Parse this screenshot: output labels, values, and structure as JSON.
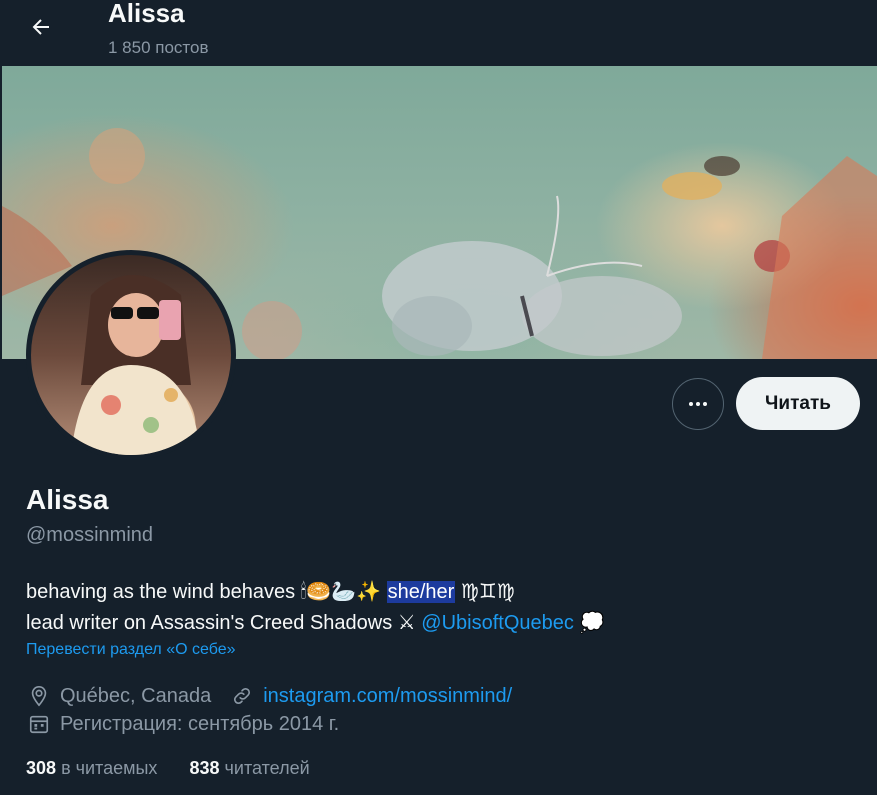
{
  "header": {
    "back_icon": "arrow-left-icon",
    "name": "Alissa",
    "posts_count": "1 850 постов"
  },
  "actions": {
    "more_icon": "more-horizontal-icon",
    "follow_label": "Читать"
  },
  "profile": {
    "name": "Alissa",
    "handle": "@mossinmind",
    "bio": {
      "line1_text": "behaving as the wind behaves",
      "line1_emojis": "🕯🥯🦢✨",
      "line1_highlight": "she/her",
      "line1_signs": "♍♊♍",
      "line2_text": "lead writer on Assassin's Creed Shadows",
      "line2_emoji": "⚔",
      "line2_mention": "@UbisoftQuebec",
      "line2_end_emoji": "💭"
    },
    "translate_label": "Перевести раздел «О себе»",
    "location": "Québec, Canada",
    "location_icon": "location-pin-icon",
    "website": "instagram.com/mossinmind/",
    "website_icon": "link-icon",
    "joined": "Регистрация: сентябрь 2014 г.",
    "joined_icon": "calendar-icon"
  },
  "stats": {
    "following_count": "308",
    "following_label": "в читаемых",
    "followers_count": "838",
    "followers_label": "читателей"
  },
  "colors": {
    "background": "#15202b",
    "link": "#1d9bf0",
    "secondary_text": "#8b98a5",
    "highlight": "#1d3b9e"
  }
}
